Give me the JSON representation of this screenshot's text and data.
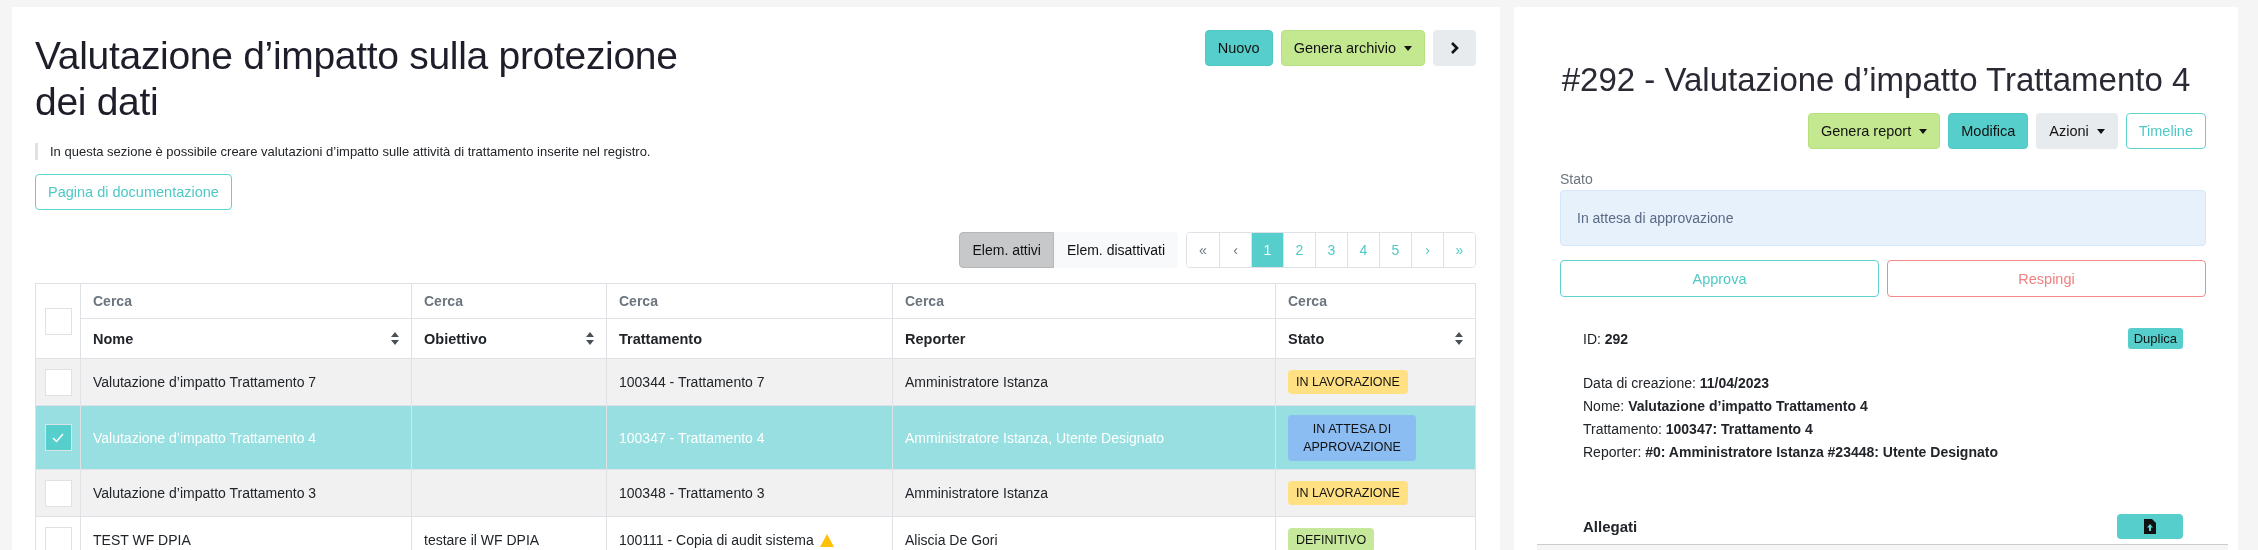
{
  "page": {
    "title": "Valutazione d’impatto sulla protezione dei dati",
    "description": "In questa sezione è possibile creare valutazioni d’impatto sulle attività di trattamento inserite nel registro.",
    "doc_link": "Pagina di documentazione"
  },
  "toolbar": [
    {
      "label": "Nuovo",
      "kind": "primary",
      "dropdown": false
    },
    {
      "label": "Genera archivio",
      "kind": "success",
      "dropdown": true
    }
  ],
  "filters": [
    {
      "label": "Elem. attivi",
      "selected": true
    },
    {
      "label": "Elem. disattivati",
      "selected": false
    }
  ],
  "pagination": [
    {
      "label": "«",
      "selected": false
    },
    {
      "label": "‹",
      "selected": false
    },
    {
      "label": "1",
      "selected": true
    },
    {
      "label": "2",
      "selected": false
    },
    {
      "label": "3",
      "selected": false
    },
    {
      "label": "4",
      "selected": false
    },
    {
      "label": "5",
      "selected": false
    },
    {
      "label": "›",
      "selected": false
    },
    {
      "label": "»",
      "selected": false
    }
  ],
  "table": {
    "select_all_checked": false,
    "columns": [
      {
        "label": "Nome",
        "placeholder": "Cerca",
        "sortable": true
      },
      {
        "label": "Obiettivo",
        "placeholder": "Cerca",
        "sortable": true
      },
      {
        "label": "Trattamento",
        "placeholder": "Cerca",
        "sortable": false
      },
      {
        "label": "Reporter",
        "placeholder": "Cerca",
        "sortable": false
      },
      {
        "label": "Stato",
        "placeholder": "Cerca",
        "sortable": true
      }
    ],
    "rows": [
      {
        "selected": false,
        "nome": "Valutazione d’impatto Trattamento 7",
        "obiettivo": "",
        "trattamento": "100344 - Trattamento 7",
        "warning": false,
        "reporter": "Amministratore Istanza",
        "stato": "IN LAVORAZIONE",
        "color": "#ffe083"
      },
      {
        "selected": true,
        "nome": "Valutazione d’impatto Trattamento 4",
        "obiettivo": "",
        "trattamento": "100347 - Trattamento 4",
        "warning": false,
        "reporter": "Amministratore Istanza, Utente Designato",
        "stato": "IN ATTESA DI APPROVAZIONE",
        "color": "#8bbcf2"
      },
      {
        "selected": false,
        "nome": "Valutazione d’impatto Trattamento 3",
        "obiettivo": "",
        "trattamento": "100348 - Trattamento 3",
        "warning": false,
        "reporter": "Amministratore Istanza",
        "stato": "IN LAVORAZIONE",
        "color": "#ffe083"
      },
      {
        "selected": false,
        "nome": "TEST WF DPIA",
        "obiettivo": "testare il WF DPIA",
        "trattamento": "100111 - Copia di audit sistema",
        "warning": true,
        "reporter": "Aliscia De Gori",
        "stato": "DEFINITIVO",
        "color": "#c5e89a"
      }
    ]
  },
  "detail": {
    "title": "#292 - Valutazione d’impatto Trattamento 4",
    "actions": [
      {
        "label": "Genera report",
        "kind": "success",
        "dropdown": true
      },
      {
        "label": "Modifica",
        "kind": "primary",
        "dropdown": false
      },
      {
        "label": "Azioni",
        "kind": "light",
        "dropdown": true
      },
      {
        "label": "Timeline",
        "kind": "outline",
        "dropdown": false
      }
    ],
    "status_label": "Stato",
    "status_value": "In attesa di approvazione",
    "approve": "Approva",
    "reject": "Respingi",
    "id_line": "ID: **292**",
    "duplicate": "Duplica",
    "fields": [
      "Data di creazione: **11/04/2023**",
      "Nome: **Valutazione d’impatto Trattamento 4**",
      "Trattamento: **100347: Trattamento 4**",
      "Reporter: **#0: Amministratore Istanza #23448: Utente Designato**"
    ],
    "attachments_label": "Allegati"
  }
}
